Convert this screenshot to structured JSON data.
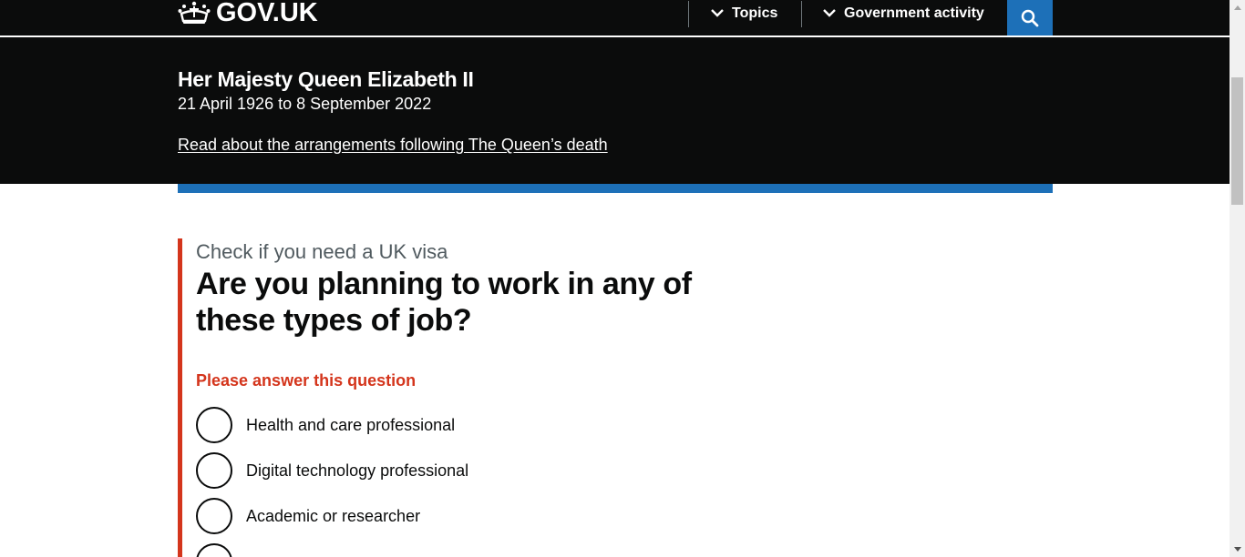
{
  "header": {
    "logo_text": "GOV.UK",
    "nav": [
      {
        "label": "Topics",
        "icon": "chevron-down-icon"
      },
      {
        "label": "Government activity",
        "icon": "chevron-down-icon"
      }
    ],
    "search_icon": "search-icon"
  },
  "banner": {
    "title": "Her Majesty Queen Elizabeth II",
    "dates": "21 April 1926 to 8 September 2022",
    "link": "Read about the arrangements following The Queen’s death"
  },
  "form": {
    "caption": "Check if you need a UK visa",
    "question": "Are you planning to work in any of these types of job?",
    "error": "Please answer this question",
    "options": [
      {
        "label": "Health and care professional"
      },
      {
        "label": "Digital technology professional"
      },
      {
        "label": "Academic or researcher"
      }
    ]
  },
  "colors": {
    "header_bg": "#0b0c0c",
    "brand_blue": "#1d70b8",
    "error_red": "#d4351c",
    "caption_grey": "#505a5f"
  }
}
